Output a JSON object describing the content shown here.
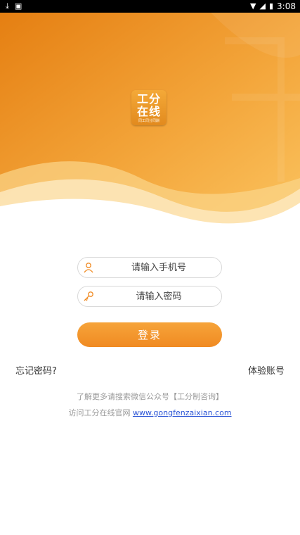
{
  "status_bar": {
    "left_icons": [
      "download-icon",
      "photo-icon"
    ],
    "right_icons": [
      "wifi-icon",
      "signal-icon",
      "battery-icon"
    ],
    "time": "3:08"
  },
  "colors": {
    "brand_orange": "#f08a22",
    "header_dark": "#e8861c",
    "header_light": "#fbc661",
    "link_blue": "#2b55d6"
  },
  "logo": {
    "line1": "工分",
    "line2": "在线",
    "caption": "同工同分同酬"
  },
  "form": {
    "phone_placeholder": "请输入手机号",
    "password_placeholder": "请输入密码",
    "login_label": "登录"
  },
  "links": {
    "forgot_password": "忘记密码?",
    "trial_account": "体验账号"
  },
  "info": {
    "wechat_line": "了解更多请搜索微信公众号【工分制咨询】",
    "site_prefix": "访问工分在线官网 ",
    "site_url": "www.gongfenzaixian.com"
  }
}
